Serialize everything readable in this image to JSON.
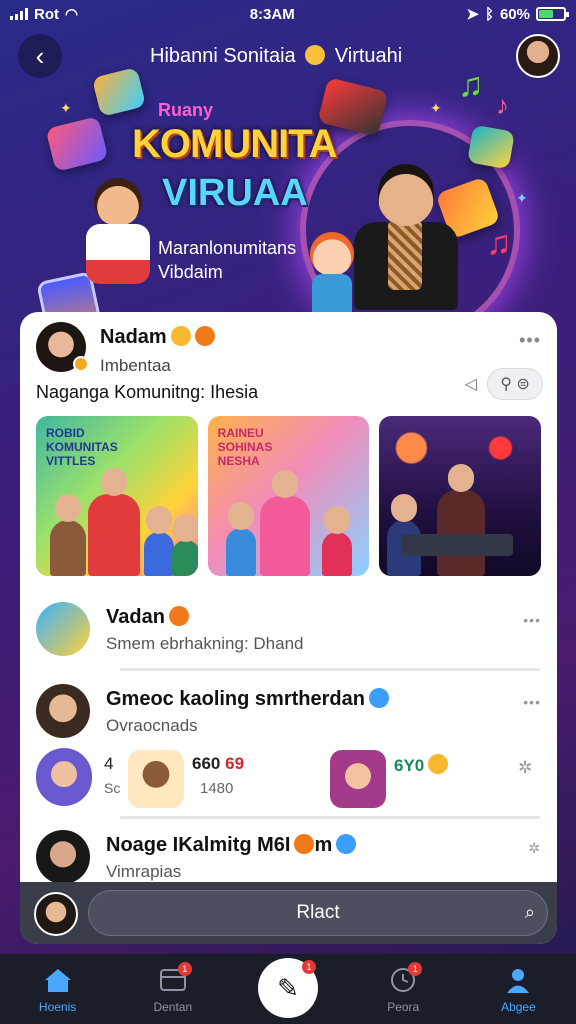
{
  "status_bar": {
    "carrier": "Rot",
    "time": "8:3AM",
    "battery": "60%",
    "battery_level": 0.6
  },
  "header": {
    "title_left": "Hibanni Sonitaia",
    "title_right": "Virtuahi"
  },
  "hero": {
    "tag": "Ruany",
    "title_line1": "KOMUNITA",
    "title_line2": "VIRUAA",
    "subtitle_line1": "Maranlonumitans",
    "subtitle_line2": "Vibdaim"
  },
  "post": {
    "author": "Nadam",
    "subtitle": "Imbentaa",
    "text": "Naganga Komunitng: Ihesia",
    "media": [
      {
        "caption_line1": "ROBID",
        "caption_line2": "KOMUNITAS",
        "caption_line3": "VITTLES"
      },
      {
        "caption_line1": "RAINEU",
        "caption_line2": "SOHINAS",
        "caption_line3": "NESHA"
      },
      {
        "caption_line1": "",
        "caption_line2": "",
        "caption_line3": ""
      }
    ]
  },
  "feed": [
    {
      "title": "Vadan",
      "subtitle": "Smem ebrhakning: Dhand"
    },
    {
      "title": "Gmeoc kaoling smrtherdan",
      "subtitle": "Ovraocnads"
    },
    {
      "title": "Noage IKalmitg M6I",
      "title_suffix": "m",
      "subtitle": "Vimrapias"
    }
  ],
  "stats": {
    "left_num": "4",
    "left_sub": "Sc",
    "middle_value": "660",
    "middle_value_red": "69",
    "middle_sub": "1480",
    "right_value": "6Y0"
  },
  "composer": {
    "placeholder": "Rlact"
  },
  "tabbar": {
    "items": [
      {
        "label": "Hoenis",
        "badge": ""
      },
      {
        "label": "Dentan",
        "badge": "1"
      },
      {
        "label": "",
        "badge": "1"
      },
      {
        "label": "Peora",
        "badge": "1"
      },
      {
        "label": "Abgee",
        "badge": ""
      }
    ]
  },
  "colors": {
    "accent": "#4aa8ff",
    "hero_yellow": "#ffd23a",
    "hero_cyan": "#59d6ff",
    "badge_red": "#e53935"
  }
}
